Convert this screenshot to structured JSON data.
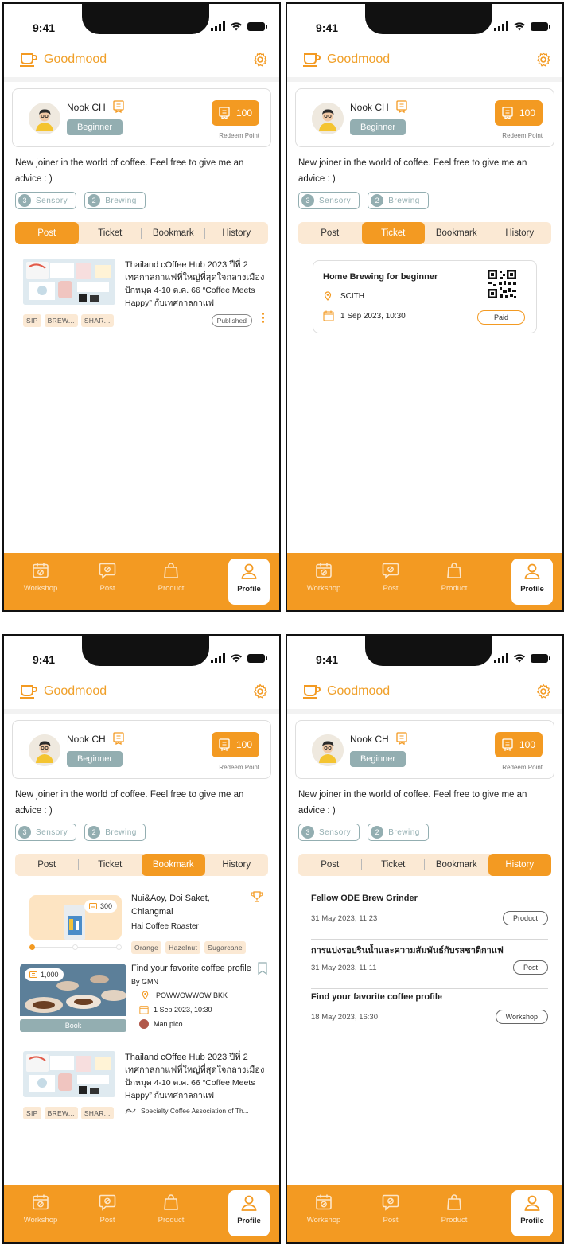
{
  "status": {
    "time": "9:41"
  },
  "header": {
    "brand": "Goodmood"
  },
  "profile": {
    "name": "Nook CH",
    "level": "Beginner",
    "points": "100",
    "points_label": "Redeem Point",
    "bio": "New joiner in the world of coffee. Feel free to give me an advice : )",
    "skills": [
      {
        "count": "3",
        "label": "Sensory"
      },
      {
        "count": "2",
        "label": "Brewing"
      }
    ]
  },
  "tabs": [
    "Post",
    "Ticket",
    "Bookmark",
    "History"
  ],
  "nav": [
    "Workshop",
    "Post",
    "Product",
    "Profile"
  ],
  "post": {
    "title": "Thailand cOffee Hub 2023 ปีที่ 2 เทศกาลกาแฟที่ใหญ่ที่สุดใจกลางเมือง",
    "desc": "ปักหมุด 4-10 ต.ค. 66 “Coffee Meets Happy” กับเทศกาลกาแฟ",
    "tags": [
      "SIP",
      "BREW...",
      "SHAR..."
    ],
    "status": "Published",
    "source": "Specialty Coffee Association of Th..."
  },
  "ticket": {
    "title": "Home Brewing for beginner",
    "location": "SCITH",
    "date": "1 Sep 2023, 10:30",
    "status": "Paid"
  },
  "bookmark_product": {
    "price": "300",
    "name": "Nui&Aoy, Doi Saket, Chiangmai",
    "roaster": "Hai Coffee Roaster",
    "notes": [
      "Orange",
      "Hazelnut",
      "Sugarcane"
    ]
  },
  "bookmark_workshop": {
    "price": "1,000",
    "title": "Find your favorite coffee profile",
    "by": "By GMN",
    "location": "POWWOWWOW BKK",
    "date": "1 Sep 2023, 10:30",
    "host": "Man.pico",
    "action": "Book"
  },
  "history": [
    {
      "title": "Fellow ODE Brew Grinder",
      "time": "31 May 2023, 11:23",
      "type": "Product"
    },
    {
      "title": "การแบ่งรอบรินน้ำและความสัมพันธ์กับรสชาติกาแฟ",
      "time": "31 May 2023, 11:11",
      "type": "Post"
    },
    {
      "title": "Find your favorite coffee profile",
      "time": "18 May 2023, 16:30",
      "type": "Workshop"
    }
  ],
  "colors": {
    "accent": "#F39A22",
    "accent_light": "#FBE9D4",
    "level": "#93AEB1"
  }
}
